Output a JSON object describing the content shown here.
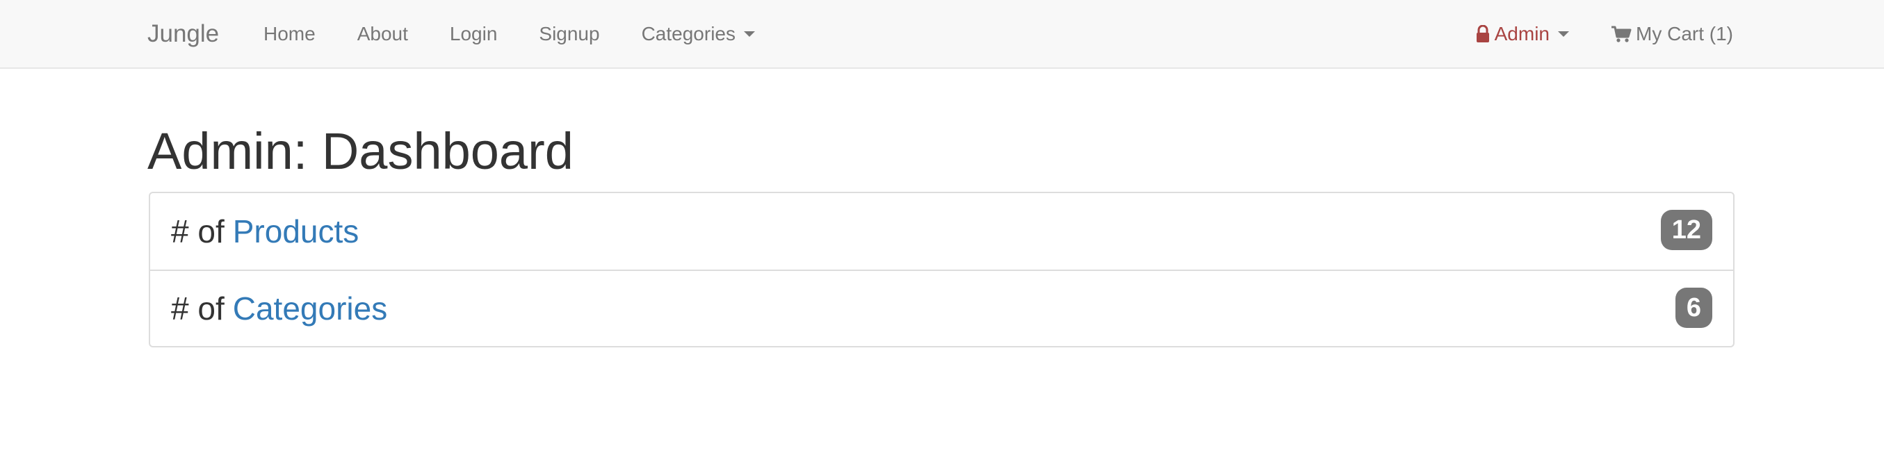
{
  "navbar": {
    "brand": "Jungle",
    "left_items": [
      {
        "label": "Home"
      },
      {
        "label": "About"
      },
      {
        "label": "Login"
      },
      {
        "label": "Signup"
      },
      {
        "label": "Categories",
        "has_dropdown": true
      }
    ],
    "admin": {
      "label": "Admin",
      "icon": "lock-icon",
      "color": "#a94442",
      "has_dropdown": true
    },
    "cart": {
      "label": "My Cart (1)",
      "icon": "shopping-cart-icon"
    }
  },
  "main": {
    "title": "Admin: Dashboard",
    "stats": [
      {
        "prefix": "# of",
        "link_label": "Products",
        "count": "12"
      },
      {
        "prefix": "# of",
        "link_label": "Categories",
        "count": "6"
      }
    ]
  },
  "colors": {
    "navbar_bg": "#f8f8f8",
    "link": "#337ab7",
    "badge_bg": "#777777",
    "admin": "#a94442"
  }
}
